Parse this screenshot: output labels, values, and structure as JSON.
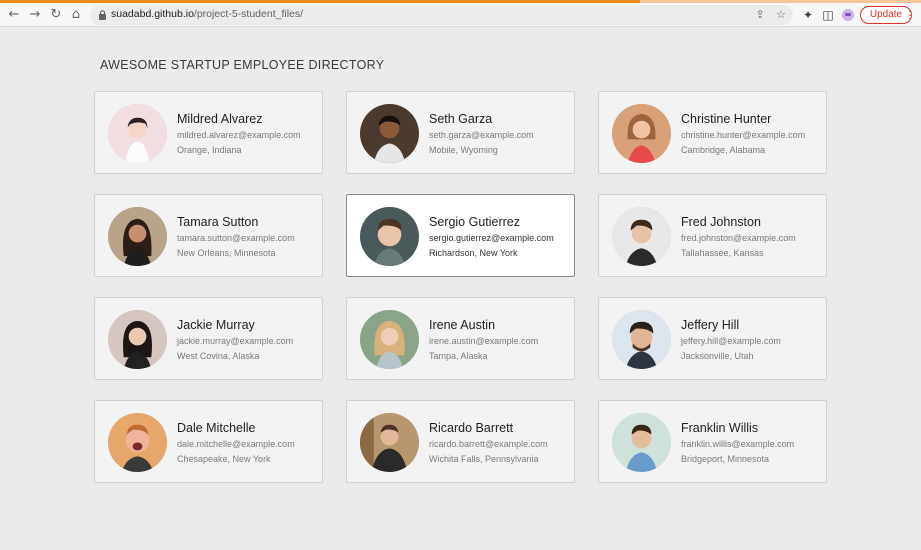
{
  "browser": {
    "url_host": "suadabd.github.io",
    "url_path": "/project-5-student_files/",
    "update_label": "Update"
  },
  "page": {
    "title": "AWESOME STARTUP EMPLOYEE DIRECTORY"
  },
  "employees": [
    {
      "name": "Mildred Alvarez",
      "email": "mildred.alvarez@example.com",
      "location": "Orange, Indiana"
    },
    {
      "name": "Seth Garza",
      "email": "seth.garza@example.com",
      "location": "Mobile, Wyoming"
    },
    {
      "name": "Christine Hunter",
      "email": "christine.hunter@example.com",
      "location": "Cambridge, Alabama"
    },
    {
      "name": "Tamara Sutton",
      "email": "tamara.sutton@example.com",
      "location": "New Orleans, Minnesota"
    },
    {
      "name": "Sergio Gutierrez",
      "email": "sergio.gutierrez@example.com",
      "location": "Richardson, New York"
    },
    {
      "name": "Fred Johnston",
      "email": "fred.johnston@example.com",
      "location": "Tallahassee, Kansas"
    },
    {
      "name": "Jackie Murray",
      "email": "jackie.murray@example.com",
      "location": "West Covina, Alaska"
    },
    {
      "name": "Irene Austin",
      "email": "irene.austin@example.com",
      "location": "Tampa, Alaska"
    },
    {
      "name": "Jeffery Hill",
      "email": "jeffery.hill@example.com",
      "location": "Jacksonville, Utah"
    },
    {
      "name": "Dale Mitchelle",
      "email": "dale.mitchelle@example.com",
      "location": "Chesapeake, New York"
    },
    {
      "name": "Ricardo Barrett",
      "email": "ricardo.barrett@example.com",
      "location": "Wichita Falls, Pennsylvania"
    },
    {
      "name": "Franklin Willis",
      "email": "franklin.willis@example.com",
      "location": "Bridgeport, Minnesota"
    }
  ],
  "colors": {
    "page_bg": "#ebebeb",
    "card_bg": "#f3f3f3",
    "card_active_bg": "#ffffff",
    "update_accent": "#d93025"
  },
  "icons": {
    "back": "arrow-left-icon",
    "forward": "arrow-right-icon",
    "reload": "reload-icon",
    "home": "home-icon",
    "lock": "lock-icon",
    "share": "share-icon",
    "bookmark": "star-icon",
    "extensions": "puzzle-icon",
    "sidebar": "sidebar-icon",
    "profile": "profile-avatar-icon",
    "menu": "kebab-menu-icon"
  }
}
